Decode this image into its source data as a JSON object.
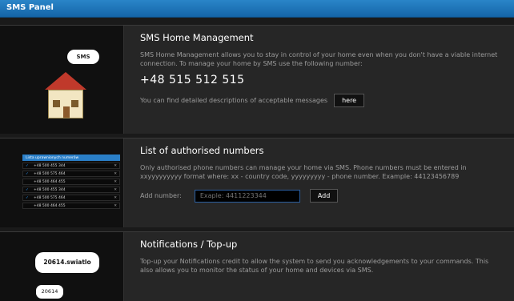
{
  "window": {
    "title": "SMS Panel"
  },
  "sections": {
    "home": {
      "title": "SMS Home Management",
      "description": "SMS Home Management allows you to stay in control of your home even when you don't have a viable internet connection. To manage your home by SMS use the following number:",
      "phone_number": "+48 515 512 515",
      "details_text": "You can find detailed descriptions of acceptable messages",
      "here_label": "here",
      "illustration_bubble": "SMS",
      "icon": "house-icon"
    },
    "authorised": {
      "title": "List of authorised numbers",
      "description": "Only authorised phone numbers can manage your home via SMS. Phone numbers must be entered in xxyyyyyyyyy format where: xx - country code, yyyyyyyyy - phone number. Example: 44123456789",
      "add_label": "Add number:",
      "input_placeholder": "Exaple: 4411223344",
      "add_button": "Add",
      "illustration": {
        "header": "Lista uprawnionych numerów",
        "rows": [
          {
            "checked": true,
            "number": "+48 500 455 344"
          },
          {
            "checked": true,
            "number": "+48 500 575 464"
          },
          {
            "checked": false,
            "number": "+48 500 464 455"
          },
          {
            "checked": true,
            "number": "+48 500 455 344"
          },
          {
            "checked": true,
            "number": "+48 500 575 464"
          },
          {
            "checked": false,
            "number": "+48 500 464 455"
          }
        ]
      }
    },
    "notifications": {
      "title": "Notifications / Top-up",
      "description": "Top-up your Notifications credit to allow the system to send you acknowledgements to your commands. This also allows you to monitor the status of your home and devices via SMS.",
      "bubble_large": "20614.swiatlo",
      "bubble_small": "20614"
    }
  },
  "colors": {
    "titlebar": "#1a72b8",
    "accent_input": "#2b7fd4"
  }
}
